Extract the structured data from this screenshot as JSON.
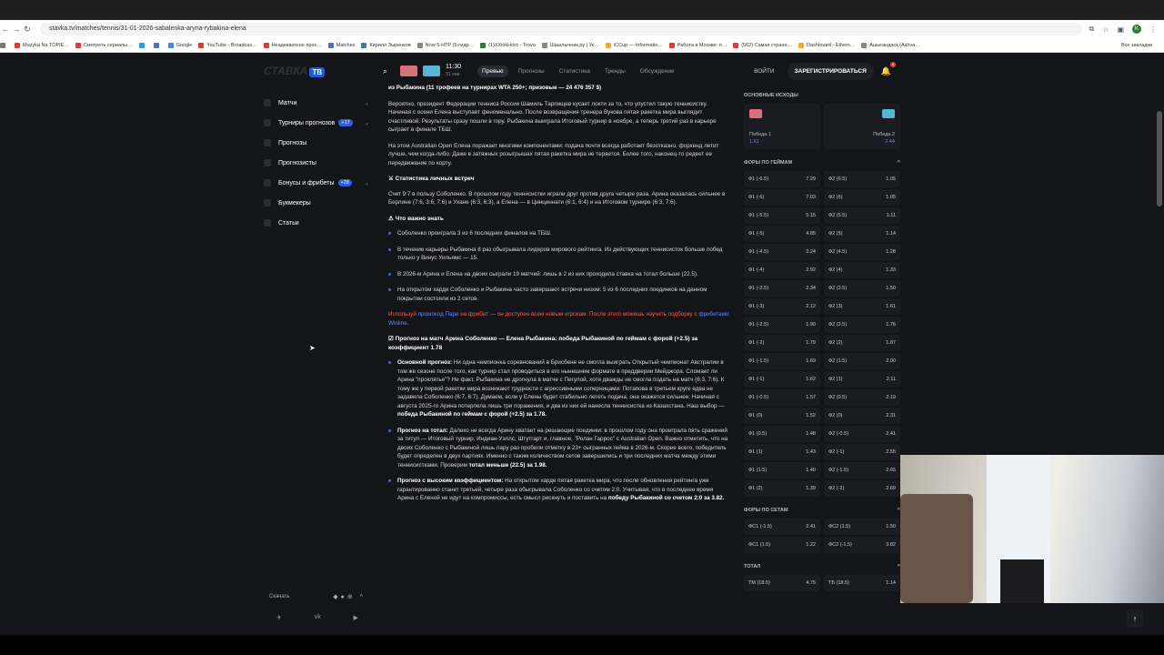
{
  "browser": {
    "url": "stavka.tv/matches/tennis/31-01-2026-sabalenka-aryna-rybakina-elena",
    "profile_initial": "K",
    "bookmarks": [
      "Muzyka Na TOPIE…",
      "Смотреть сериалы…",
      "",
      "",
      "Google",
      "YouTube - Broadcas…",
      "Неадекватное прох…",
      "Matches",
      "Кирилл Зыренков",
      "Now 5-HTP (5-гидр…",
      "(1)XXinkHoro - Trovo",
      "Шашлычник.ру | Ус…",
      "iCCup — Informatio…",
      "Работа в Москве: п…",
      "(562) Самая странн…",
      "Dashboard - Ethem…",
      "Ашыгандасқ (Ashva…"
    ],
    "bookmarks_right": "Все закладки"
  },
  "site": {
    "logo_text": "СТАВКА",
    "logo_badge": "ТВ",
    "menu": [
      {
        "label": "Матчи",
        "badge": "",
        "chevron": true
      },
      {
        "label": "Турниры прогнозов",
        "badge": "+17",
        "chevron": true
      },
      {
        "label": "Прогнозы",
        "badge": "",
        "chevron": false
      },
      {
        "label": "Прогнозисты",
        "badge": "",
        "chevron": false
      },
      {
        "label": "Бонусы и фрибеты",
        "badge": "+28",
        "chevron": true
      },
      {
        "label": "Букмекеры",
        "badge": "",
        "chevron": false
      },
      {
        "label": "Статьи",
        "badge": "",
        "chevron": false
      }
    ],
    "download_label": "Скачать",
    "header": {
      "time": "11:30",
      "date": "31 янв",
      "tabs": [
        "Превью",
        "Прогнозы",
        "Статистика",
        "Тренды",
        "Обсуждение"
      ],
      "login": "ВОЙТИ",
      "register": "ЗАРЕГИСТРИРОВАТЬСЯ",
      "notifications": "8"
    }
  },
  "article": {
    "intro_bold": "из Рыбакина (11 трофеев на турнирах WTA 250+; призовые — 24 476 357 $)",
    "p1": "Вероятно, президент Федерации тенниса России Шамиль Тарпищев кусает локти за то, что упустил такую теннисистку. Начиная с осени Елена выступает феноменально. После возвращения тренера Вукова пятая ракетка мира выглядит счастливой. Результаты сразу пошли в гору. Рыбакина выиграла Итоговый турнир в ноябре, а теперь третий раз в карьере сыграет в финале ТБШ.",
    "p2": "На этом Australian Open Елена поражает многими компонентами: подача почти всегда работает безотказно, форхенд летит лучше, чем когда-либо. Даже в затяжных розыгрышах пятая ракетка мира не теряется. Более того, наконец-то редеет ее передвижение по корту.",
    "h_stats": "⚔ Статистика личных встреч",
    "p3": "Счет 9:7 в пользу Соболенко. В прошлом году теннисистки играли друг против друга четыре раза. Арина оказалась сильнее в Берлине (7:6, 3:6, 7:6) и Ухане (6:3, 6:3), а Елена — в Цинциннати (6:1, 6:4) и на Итоговом турнире (6:3, 7:6).",
    "h_important": "⚠ Что важно знать",
    "facts": [
      "Соболенко проиграла 3 из 6 последних финалов на ТБШ.",
      "В течение карьеры Рыбакина 8 раз обыгрывала лидеров мирового рейтинга. Из действующих теннисисток больше побед только у Винус Уильямс — 15.",
      "В 2026-м Арина и Елена на двоих сыграли 19 матчей: лишь в 2 из них проходила ставка на тотал больше (22.5).",
      "На открытом харде Соболенко и Рыбакина часто завершают встречи низом: 5 из 6 последних поединков на данном покрытии состояли из 2 сетов."
    ],
    "promo_1": "Используй ",
    "promo_link1": "промокод Пари",
    "promo_2": " на фрибет — он доступен всем новым игрокам. После этого можешь изучить подборку с ",
    "promo_link2": "фрибетами Winline",
    "promo_3": ".",
    "h_forecast": "☑ Прогноз на матч Арина Соболенко — Елена Рыбакина: победа Рыбакиной по геймам с форой (+2.5) за коэффициент 1.78",
    "main_label": "Основной прогноз:",
    "main_text": " Ни одна чемпионка соревнований в Брисбене не смогла выиграть Открытый чемпионат Австралии в том же сезоне после того, как турнир стал проводиться в его нынешнем формате в преддверии Мейджора. Сломает ли Арина \"проклятье\"? Не факт. Рыбакина не дрогнула в матче с Пегулой, хотя дважды не смогла подать на матч (6:3, 7:6). К тому же у первой ракетки мира возникают трудности с агрессивными соперницами: Потапова в третьем круге едва не задавила Соболенко (6:7, 6:7). Думаем, если у Елены будет стабильно лететь подача, она окажется сильнее. Начиная с августа 2025-го Арина потерпела лишь три поражения, и два из них ей нанесла теннисистка из Казахстана. Наш выбор — ",
    "main_strong": "победа Рыбакиной по геймам с форой (+2.5) за 1.78.",
    "total_label": "Прогноз на тотал:",
    "total_text": " Далеко не всегда Арину хватает на решающие поединки: в прошлом году она проиграла пять сражений за титул — Итоговый турнир, Индиан-Уэллс, Штутгарт и, главное, \"Ролан Гаррос\" с Australian Open. Важно отметить, что на двоих Соболенко с Рыбакиной лишь пару раз пробили отметку в 23+ сыгранных гейма в 2026-м. Скорее всего, победитель будет определен в двух партиях. Именно с таким количеством сетов завершились и три последних матча между этими теннисистками. Проверим ",
    "total_strong": "тотал меньше (22.5) за 1.98.",
    "high_label": "Прогноз с высоким коэффициентом:",
    "high_text": " На открытом харде пятая ракетка мира, что после обновления рейтинга уже гарантированно станет третьей, четыре раза обыгрывала Соболенко со счетом 2:0. Учитывая, что в последнее время Арина с Еленой не идут на компромиссы, есть смысл рискнуть и поставить на ",
    "high_strong": "победу Рыбакиной со счетом 2:0 за 3.82."
  },
  "odds": {
    "main_title": "ОСНОВНЫЕ ИСХОДЫ",
    "win1_label": "Победа 1",
    "win1_value": "1.61",
    "win2_label": "Победа 2",
    "win2_value": "2.44",
    "fora_title": "ФОРЫ ПО ГЕЙМАМ",
    "fora": [
      [
        "Ф1 (-6.5)",
        "7.29",
        "Ф2 (6.5)",
        "1.05"
      ],
      [
        "Ф1 (-6)",
        "7.03",
        "Ф2 (6)",
        "1.05"
      ],
      [
        "Ф1 (-5.5)",
        "5.15",
        "Ф2 (5.5)",
        "1.11"
      ],
      [
        "Ф1 (-5)",
        "4.85",
        "Ф2 (5)",
        "1.14"
      ],
      [
        "Ф1 (-4.5)",
        "3.24",
        "Ф2 (4.5)",
        "1.28"
      ],
      [
        "Ф1 (-4)",
        "2.92",
        "Ф2 (4)",
        "1.33"
      ],
      [
        "Ф1 (-3.5)",
        "2.34",
        "Ф2 (3.5)",
        "1.50"
      ],
      [
        "Ф1 (-3)",
        "2.12",
        "Ф2 (3)",
        "1.61"
      ],
      [
        "Ф1 (-2.5)",
        "1.90",
        "Ф2 (2.5)",
        "1.76"
      ],
      [
        "Ф1 (-2)",
        "1.79",
        "Ф2 (2)",
        "1.87"
      ],
      [
        "Ф1 (-1.5)",
        "1.69",
        "Ф2 (1.5)",
        "2.00"
      ],
      [
        "Ф1 (-1)",
        "1.62",
        "Ф2 (1)",
        "2.11"
      ],
      [
        "Ф1 (-0.5)",
        "1.57",
        "Ф2 (0.5)",
        "2.19"
      ],
      [
        "Ф1 (0)",
        "1.52",
        "Ф2 (0)",
        "2.31"
      ],
      [
        "Ф1 (0.5)",
        "1.48",
        "Ф2 (-0.5)",
        "2.41"
      ],
      [
        "Ф1 (1)",
        "1.43",
        "Ф2 (-1)",
        "2.55"
      ],
      [
        "Ф1 (1.5)",
        "1.40",
        "Ф2 (-1.5)",
        "2.65"
      ],
      [
        "Ф1 (2)",
        "1.39",
        "Ф2 (-2)",
        "2.69"
      ]
    ],
    "sets_title": "ФОРЫ ПО СЕТАМ",
    "sets": [
      [
        "ФС1 (-1.5)",
        "2.41",
        "ФС2 (1.5)",
        "1.50"
      ],
      [
        "ФС1 (1.5)",
        "1.22",
        "ФС2 (-1.5)",
        "3.82"
      ]
    ],
    "total_title": "ТОТАЛ",
    "total": [
      [
        "ТМ (18.5)",
        "4.75",
        "ТБ (18.5)",
        "1.14"
      ]
    ]
  },
  "colors": {
    "accent": "#2d5de0",
    "bg": "#141519",
    "promo": "#ff5a4f"
  }
}
